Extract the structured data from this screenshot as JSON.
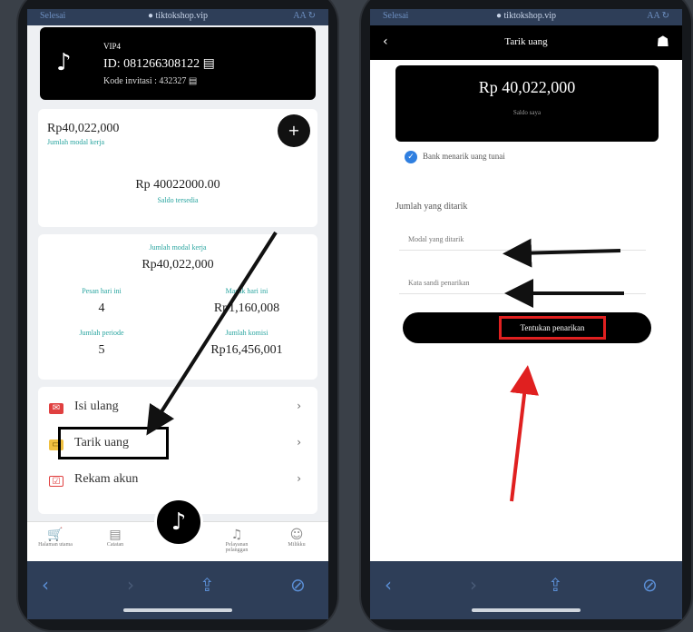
{
  "left": {
    "urlbar": {
      "left": "Selesai",
      "center": "● tiktokshop.vip",
      "right": "AA  ↻"
    },
    "account": {
      "vip": "VIP4",
      "id": "ID: 081266308122 ▤",
      "kode": "Kode invitasi : 432327 ▤"
    },
    "balance": {
      "value": "Rp40,022,000",
      "label": "Jumlah modal kerja",
      "center_value": "Rp 40022000.00",
      "center_label": "Saldo tersedia"
    },
    "stats": {
      "title": "Jumlah modal kerja",
      "total": "Rp40,022,000",
      "items": [
        {
          "label": "Pesan hari ini",
          "value": "4"
        },
        {
          "label": "Masuk hari ini",
          "value": "Rp1,160,008"
        },
        {
          "label": "Jumlah periode",
          "value": "5"
        },
        {
          "label": "Jumlah komisi",
          "value": "Rp16,456,001"
        }
      ]
    },
    "menu": [
      {
        "icon": "✉",
        "label": "Isi ulang"
      },
      {
        "icon": "▭",
        "label": "Tarik uang"
      },
      {
        "icon": "☑",
        "label": "Rekam akun"
      }
    ],
    "tabs": [
      {
        "icon": "🛒",
        "label": "Halaman utama"
      },
      {
        "icon": "▤",
        "label": "Catatan"
      },
      {
        "icon": "♫",
        "label": "Pelayanan pelanggan"
      },
      {
        "icon": "☺",
        "label": "Milikku"
      }
    ]
  },
  "right": {
    "urlbar": {
      "left": "Selesai",
      "center": "● tiktokshop.vip",
      "right": "AA  ↻"
    },
    "header": {
      "back": "‹",
      "title": "Tarik uang",
      "profile_icon": "☗"
    },
    "amount": {
      "value": "Rp 40,022,000",
      "label": "Saldo saya"
    },
    "checkbox_label": "Bank menarik uang tunai",
    "field_label": "Jumlah yang ditarik",
    "input1_placeholder": "Modal yang ditarik",
    "input2_placeholder": "Kata sandi penarikan",
    "submit_label": "Tentukan penarikan"
  },
  "colors": {
    "accent": "#2aa5a0",
    "highlight_red": "#e02020",
    "arrow": "#111111"
  }
}
